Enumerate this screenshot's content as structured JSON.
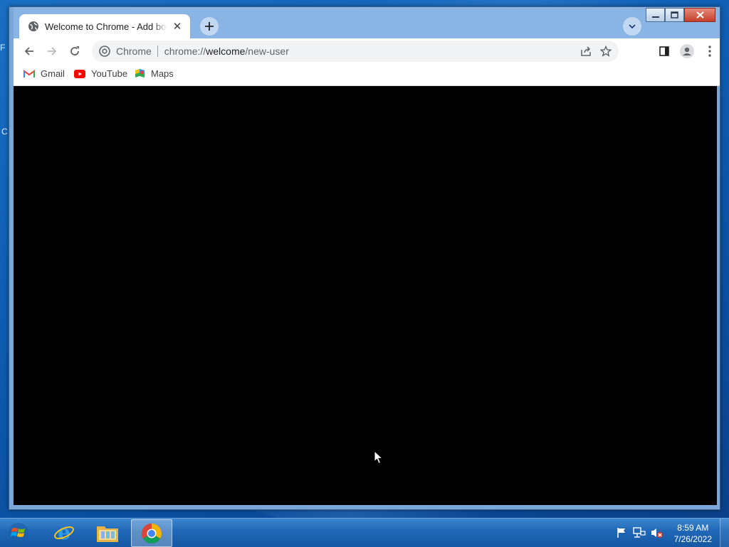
{
  "desktop": {
    "edge_letters": [
      "F",
      "C"
    ]
  },
  "browser": {
    "tab": {
      "title": "Welcome to Chrome - Add bookmarks"
    },
    "omnibox": {
      "chip": "Chrome",
      "url_prefix": "chrome://",
      "url_host": "welcome",
      "url_path": "/new-user"
    },
    "bookmarks": [
      {
        "label": "Gmail",
        "icon": "gmail-icon"
      },
      {
        "label": "YouTube",
        "icon": "youtube-icon"
      },
      {
        "label": "Maps",
        "icon": "maps-icon"
      }
    ]
  },
  "taskbar": {
    "apps": [
      {
        "name": "Internet Explorer",
        "icon": "internet-explorer-icon"
      },
      {
        "name": "File Explorer",
        "icon": "file-explorer-icon"
      },
      {
        "name": "Google Chrome",
        "icon": "chrome-icon",
        "active": true
      }
    ],
    "clock": {
      "time": "8:59 AM",
      "date": "7/26/2022"
    }
  },
  "colors": {
    "tabstrip": "#8ab4e4",
    "content": "#000000",
    "taskbar": "#1f67b6"
  }
}
